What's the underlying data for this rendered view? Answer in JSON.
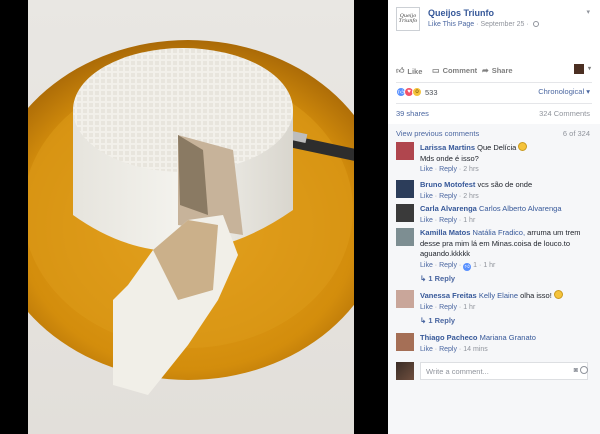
{
  "post": {
    "page_name": "Queijos Triunfo",
    "page_logo_text": "Queijo Triunfo",
    "like_page": "Like This Page",
    "date": "September 25",
    "separator": "·"
  },
  "actions": {
    "like": "Like",
    "comment": "Comment",
    "share": "Share"
  },
  "reactions": {
    "count": "533",
    "order_label": "Chronological"
  },
  "stats": {
    "shares": "39 shares",
    "comments": "324 Comments"
  },
  "comments_header": {
    "view_previous": "View previous comments",
    "pager": "6 of 324"
  },
  "comments": [
    {
      "author": "Larissa Martins",
      "text": "Que Delícia",
      "text2": "Mds onde é isso?",
      "like": "Like",
      "reply": "Reply",
      "time": "2 hrs",
      "avatar_color": "#b0464e"
    },
    {
      "author": "Bruno Motofest",
      "text": "vcs são de onde",
      "like": "Like",
      "reply": "Reply",
      "time": "2 hrs",
      "avatar_color": "#2c3d5a"
    },
    {
      "author": "Carla Alvarenga",
      "tag": "Carlos Alberto Alvarenga",
      "like": "Like",
      "reply": "Reply",
      "time": "1 hr",
      "avatar_color": "#3a3a3a"
    },
    {
      "author": "Kamilla Matos",
      "tag": "Natália Fradico,",
      "text": "arruma um trem desse pra mim lá em Minas.coisa de louco.to aguando.kkkkk",
      "like": "Like",
      "reply": "Reply",
      "reactions": "1",
      "time": "1 hr",
      "replies": "1 Reply",
      "avatar_color": "#7d8e92"
    },
    {
      "author": "Vanessa Freitas",
      "tag": "Kelly Elaine",
      "text": "olha isso!",
      "like": "Like",
      "reply": "Reply",
      "time": "1 hr",
      "replies": "1 Reply",
      "avatar_color": "#c9a69a"
    },
    {
      "author": "Thiago Pacheco",
      "tag": "Mariana Granato",
      "like": "Like",
      "reply": "Reply",
      "time": "14 mins",
      "avatar_color": "#a56f56"
    }
  ],
  "composer": {
    "placeholder": "Write a comment..."
  },
  "colors": {
    "link": "#365899",
    "muted": "#90949c",
    "plate": "#d9950f"
  }
}
